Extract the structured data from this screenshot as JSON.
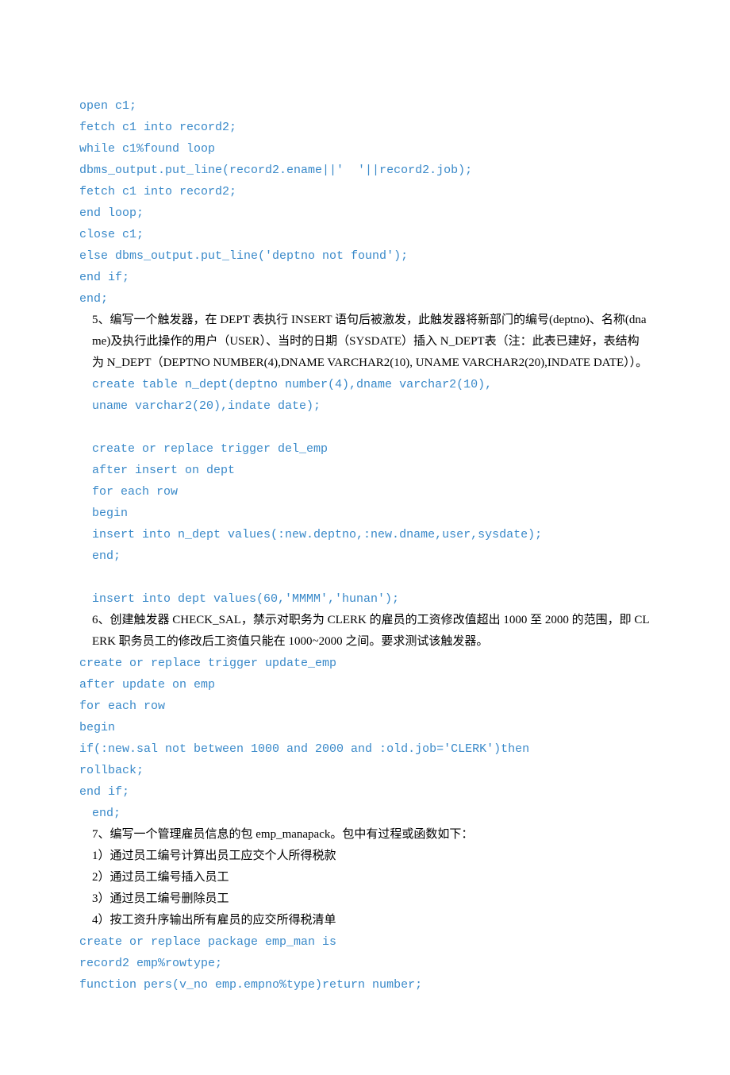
{
  "lines": [
    {
      "cls": "line code",
      "text": "open c1;"
    },
    {
      "cls": "line code",
      "text": "fetch c1 into record2;"
    },
    {
      "cls": "line code",
      "text": "while c1%found loop"
    },
    {
      "cls": "line code",
      "text": "dbms_output.put_line(record2.ename||'  '||record2.job);"
    },
    {
      "cls": "line code",
      "text": "fetch c1 into record2;"
    },
    {
      "cls": "line code",
      "text": "end loop;"
    },
    {
      "cls": "line code",
      "text": "close c1;"
    },
    {
      "cls": "line code",
      "text": "else dbms_output.put_line('deptno not found');"
    },
    {
      "cls": "line code",
      "text": "end if;"
    },
    {
      "cls": "line code",
      "text": "end;"
    },
    {
      "cls": "line text indent",
      "text": "5、编写一个触发器，在 DEPT 表执行 INSERT 语句后被激发，此触发器将新部门的编号(deptno)、名称(dname)及执行此操作的用户（USER）、当时的日期（SYSDATE）插入 N_DEPT表（注：此表已建好，表结构为 N_DEPT（DEPTNO NUMBER(4),DNAME VARCHAR2(10), UNAME VARCHAR2(20),INDATE DATE））。"
    },
    {
      "cls": "line code indent",
      "text": "create table n_dept(deptno number(4),dname varchar2(10),"
    },
    {
      "cls": "line code indent",
      "text": "uname varchar2(20),indate date);"
    },
    {
      "cls": "line",
      "text": " "
    },
    {
      "cls": "line code indent",
      "text": "create or replace trigger del_emp"
    },
    {
      "cls": "line code indent",
      "text": "after insert on dept"
    },
    {
      "cls": "line code indent",
      "text": "for each row"
    },
    {
      "cls": "line code indent",
      "text": "begin"
    },
    {
      "cls": "line code indent",
      "text": "insert into n_dept values(:new.deptno,:new.dname,user,sysdate);"
    },
    {
      "cls": "line code indent",
      "text": "end;"
    },
    {
      "cls": "line",
      "text": " "
    },
    {
      "cls": "line code indent",
      "text": "insert into dept values(60,'MMMM','hunan');"
    },
    {
      "cls": "line text indent",
      "text": "6、创建触发器 CHECK_SAL，禁示对职务为 CLERK 的雇员的工资修改值超出 1000 至 2000 的范围，即 CLERK 职务员工的修改后工资值只能在 1000~2000 之间。要求测试该触发器。"
    },
    {
      "cls": "line code",
      "text": "create or replace trigger update_emp"
    },
    {
      "cls": "line code",
      "text": "after update on emp"
    },
    {
      "cls": "line code",
      "text": "for each row"
    },
    {
      "cls": "line code",
      "text": "begin"
    },
    {
      "cls": "line code",
      "text": "if(:new.sal not between 1000 and 2000 and :old.job='CLERK')then"
    },
    {
      "cls": "line code",
      "text": "rollback;"
    },
    {
      "cls": "line code",
      "text": "end if;"
    },
    {
      "cls": "line code indent",
      "text": "end;"
    },
    {
      "cls": "line text indent",
      "text": "7、编写一个管理雇员信息的包 emp_manapack。包中有过程或函数如下："
    },
    {
      "cls": "line text indent",
      "text": "1）通过员工编号计算出员工应交个人所得税款"
    },
    {
      "cls": "line text indent",
      "text": "2）通过员工编号插入员工"
    },
    {
      "cls": "line text indent",
      "text": "3）通过员工编号删除员工"
    },
    {
      "cls": "line text indent",
      "text": "4）按工资升序输出所有雇员的应交所得税清单"
    },
    {
      "cls": "line code",
      "text": "create or replace package emp_man is"
    },
    {
      "cls": "line code",
      "text": "record2 emp%rowtype;"
    },
    {
      "cls": "line code",
      "text": "function pers(v_no emp.empno%type)return number;"
    }
  ]
}
